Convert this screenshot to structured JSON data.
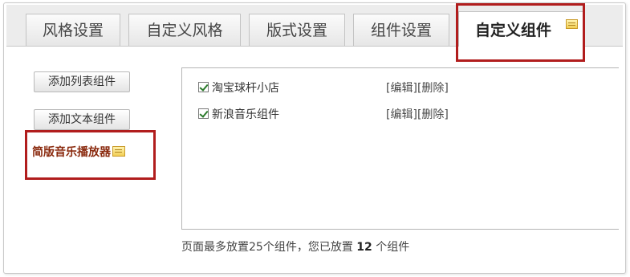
{
  "tabs": [
    {
      "label": "风格设置",
      "active": false
    },
    {
      "label": "自定义风格",
      "active": false
    },
    {
      "label": "版式设置",
      "active": false
    },
    {
      "label": "组件设置",
      "active": false
    },
    {
      "label": "自定义组件",
      "active": true
    }
  ],
  "sidebar": {
    "add_list_label": "添加列表组件",
    "add_text_label": "添加文本组件",
    "player_label": "简版音乐播放器"
  },
  "components": [
    {
      "name": "淘宝球杆小店",
      "checked": true,
      "edit": "[编辑]",
      "delete": "[删除]"
    },
    {
      "name": "新浪音乐组件",
      "checked": true,
      "edit": "[编辑]",
      "delete": "[删除]"
    }
  ],
  "footer": {
    "prefix": "页面最多放置25个组件，您已放置",
    "count": "12",
    "suffix": "个组件"
  },
  "colors": {
    "highlight": "#b11d1d",
    "player_text": "#8a2a0e",
    "tabbar_bg": "#ececec"
  },
  "icons": {
    "tab_badge": "note-icon",
    "player_badge": "note-icon",
    "checkbox": "check-icon"
  }
}
